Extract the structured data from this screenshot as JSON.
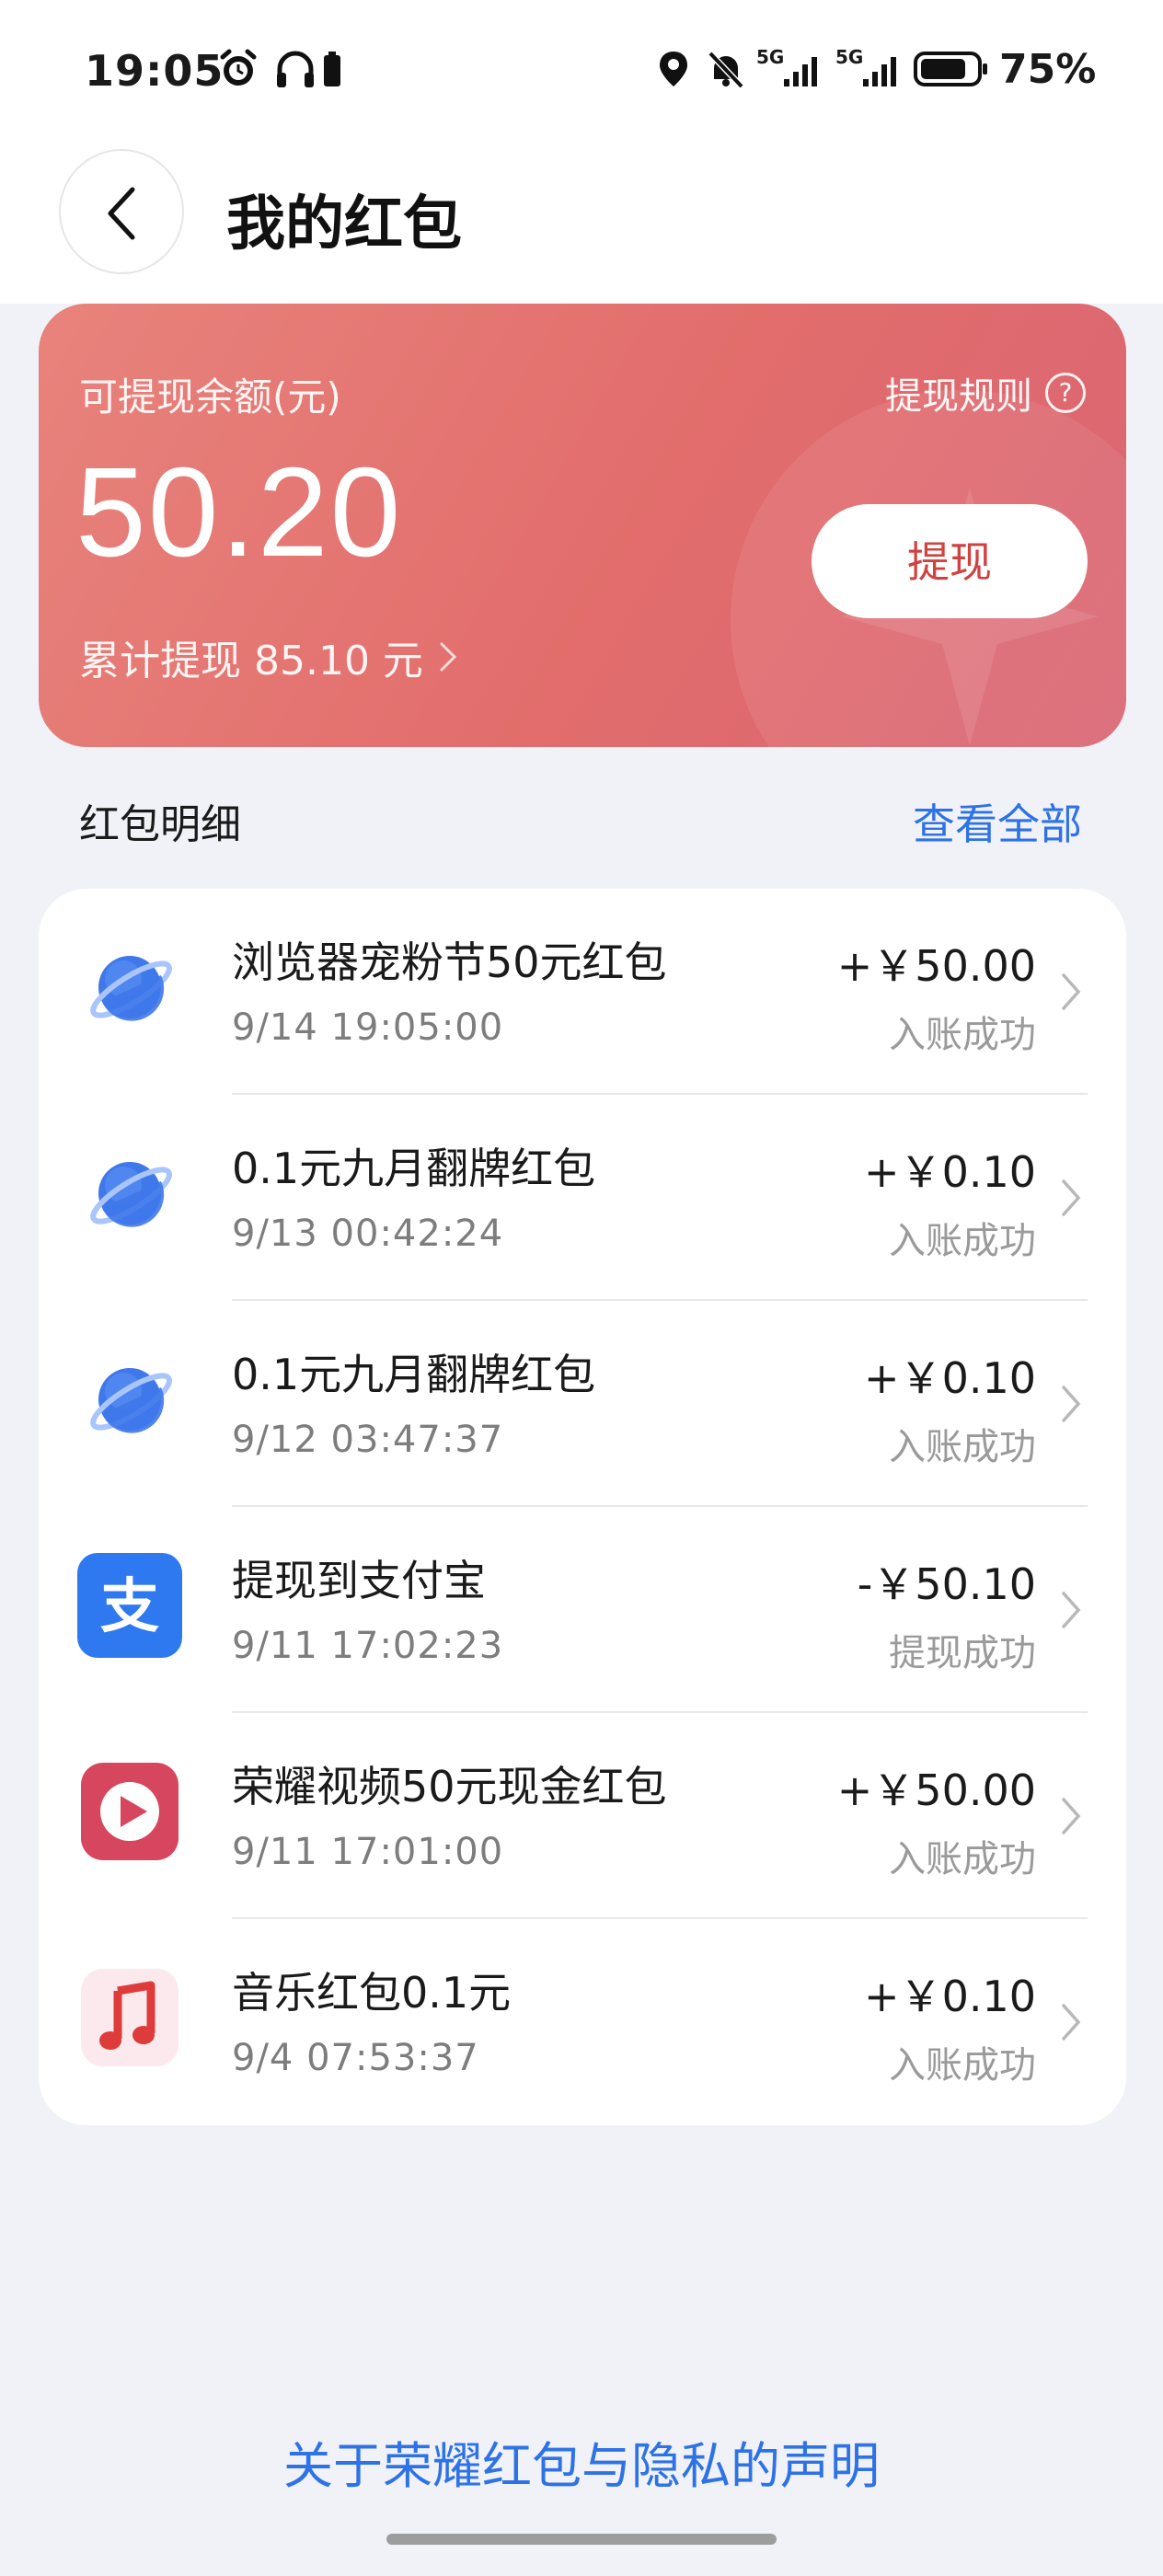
{
  "status_bar": {
    "time": "19:05",
    "battery_text": "75%",
    "icons": [
      "alarm-icon",
      "headphones-icon",
      "battery-small-icon",
      "location-icon",
      "mute-icon",
      "signal-5g-icon",
      "signal-5g-icon",
      "battery-icon"
    ],
    "network_label_1": "5G",
    "network_label_2": "5G"
  },
  "header": {
    "title": "我的红包",
    "back_icon": "chevron-left-icon"
  },
  "balance_card": {
    "label": "可提现余额(元)",
    "rule_label": "提现规则",
    "rule_icon": "question-icon",
    "rule_icon_text": "?",
    "amount": "50.20",
    "total_label": "累计提现 85.10 元",
    "withdraw_label": "提现",
    "gradient_from": "#e8837c",
    "gradient_to": "#da6573"
  },
  "section": {
    "title": "红包明细",
    "view_all": "查看全部"
  },
  "records": [
    {
      "icon": "browser-planet-icon",
      "title": "浏览器宠粉节50元红包",
      "time": "9/14 19:05:00",
      "amount": "+￥50.00",
      "status": "入账成功"
    },
    {
      "icon": "browser-planet-icon",
      "title": "0.1元九月翻牌红包",
      "time": "9/13 00:42:24",
      "amount": "+￥0.10",
      "status": "入账成功"
    },
    {
      "icon": "browser-planet-icon",
      "title": "0.1元九月翻牌红包",
      "time": "9/12 03:47:37",
      "amount": "+￥0.10",
      "status": "入账成功"
    },
    {
      "icon": "alipay-icon",
      "icon_text": "支",
      "title": "提现到支付宝",
      "time": "9/11 17:02:23",
      "amount": "-￥50.10",
      "status": "提现成功"
    },
    {
      "icon": "video-play-icon",
      "title": "荣耀视频50元现金红包",
      "time": "9/11 17:01:00",
      "amount": "+￥50.00",
      "status": "入账成功"
    },
    {
      "icon": "music-note-icon",
      "title": "音乐红包0.1元",
      "time": "9/4 07:53:37",
      "amount": "+￥0.10",
      "status": "入账成功"
    }
  ],
  "footer": {
    "link": "关于荣耀红包与隐私的声明"
  },
  "colors": {
    "accent": "#2d72e6",
    "withdraw_text": "#d0423f",
    "background": "#f1f2f7"
  }
}
